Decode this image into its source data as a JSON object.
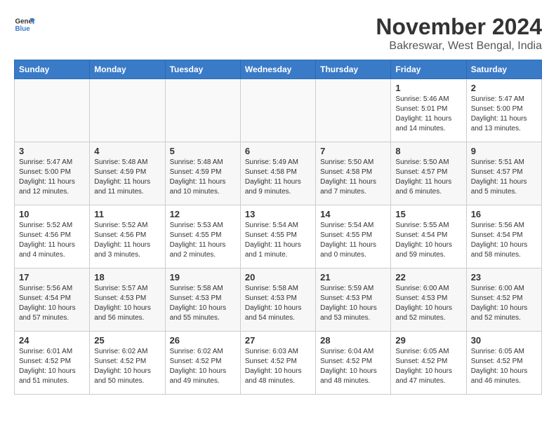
{
  "logo": {
    "line1": "General",
    "line2": "Blue"
  },
  "title": "November 2024",
  "location": "Bakreswar, West Bengal, India",
  "days_of_week": [
    "Sunday",
    "Monday",
    "Tuesday",
    "Wednesday",
    "Thursday",
    "Friday",
    "Saturday"
  ],
  "weeks": [
    {
      "days": [
        {
          "number": "",
          "empty": true
        },
        {
          "number": "",
          "empty": true
        },
        {
          "number": "",
          "empty": true
        },
        {
          "number": "",
          "empty": true
        },
        {
          "number": "",
          "empty": true
        },
        {
          "number": "1",
          "sunrise": "Sunrise: 5:46 AM",
          "sunset": "Sunset: 5:01 PM",
          "daylight": "Daylight: 11 hours and 14 minutes."
        },
        {
          "number": "2",
          "sunrise": "Sunrise: 5:47 AM",
          "sunset": "Sunset: 5:00 PM",
          "daylight": "Daylight: 11 hours and 13 minutes."
        }
      ]
    },
    {
      "days": [
        {
          "number": "3",
          "sunrise": "Sunrise: 5:47 AM",
          "sunset": "Sunset: 5:00 PM",
          "daylight": "Daylight: 11 hours and 12 minutes."
        },
        {
          "number": "4",
          "sunrise": "Sunrise: 5:48 AM",
          "sunset": "Sunset: 4:59 PM",
          "daylight": "Daylight: 11 hours and 11 minutes."
        },
        {
          "number": "5",
          "sunrise": "Sunrise: 5:48 AM",
          "sunset": "Sunset: 4:59 PM",
          "daylight": "Daylight: 11 hours and 10 minutes."
        },
        {
          "number": "6",
          "sunrise": "Sunrise: 5:49 AM",
          "sunset": "Sunset: 4:58 PM",
          "daylight": "Daylight: 11 hours and 9 minutes."
        },
        {
          "number": "7",
          "sunrise": "Sunrise: 5:50 AM",
          "sunset": "Sunset: 4:58 PM",
          "daylight": "Daylight: 11 hours and 7 minutes."
        },
        {
          "number": "8",
          "sunrise": "Sunrise: 5:50 AM",
          "sunset": "Sunset: 4:57 PM",
          "daylight": "Daylight: 11 hours and 6 minutes."
        },
        {
          "number": "9",
          "sunrise": "Sunrise: 5:51 AM",
          "sunset": "Sunset: 4:57 PM",
          "daylight": "Daylight: 11 hours and 5 minutes."
        }
      ]
    },
    {
      "days": [
        {
          "number": "10",
          "sunrise": "Sunrise: 5:52 AM",
          "sunset": "Sunset: 4:56 PM",
          "daylight": "Daylight: 11 hours and 4 minutes."
        },
        {
          "number": "11",
          "sunrise": "Sunrise: 5:52 AM",
          "sunset": "Sunset: 4:56 PM",
          "daylight": "Daylight: 11 hours and 3 minutes."
        },
        {
          "number": "12",
          "sunrise": "Sunrise: 5:53 AM",
          "sunset": "Sunset: 4:55 PM",
          "daylight": "Daylight: 11 hours and 2 minutes."
        },
        {
          "number": "13",
          "sunrise": "Sunrise: 5:54 AM",
          "sunset": "Sunset: 4:55 PM",
          "daylight": "Daylight: 11 hours and 1 minute."
        },
        {
          "number": "14",
          "sunrise": "Sunrise: 5:54 AM",
          "sunset": "Sunset: 4:55 PM",
          "daylight": "Daylight: 11 hours and 0 minutes."
        },
        {
          "number": "15",
          "sunrise": "Sunrise: 5:55 AM",
          "sunset": "Sunset: 4:54 PM",
          "daylight": "Daylight: 10 hours and 59 minutes."
        },
        {
          "number": "16",
          "sunrise": "Sunrise: 5:56 AM",
          "sunset": "Sunset: 4:54 PM",
          "daylight": "Daylight: 10 hours and 58 minutes."
        }
      ]
    },
    {
      "days": [
        {
          "number": "17",
          "sunrise": "Sunrise: 5:56 AM",
          "sunset": "Sunset: 4:54 PM",
          "daylight": "Daylight: 10 hours and 57 minutes."
        },
        {
          "number": "18",
          "sunrise": "Sunrise: 5:57 AM",
          "sunset": "Sunset: 4:53 PM",
          "daylight": "Daylight: 10 hours and 56 minutes."
        },
        {
          "number": "19",
          "sunrise": "Sunrise: 5:58 AM",
          "sunset": "Sunset: 4:53 PM",
          "daylight": "Daylight: 10 hours and 55 minutes."
        },
        {
          "number": "20",
          "sunrise": "Sunrise: 5:58 AM",
          "sunset": "Sunset: 4:53 PM",
          "daylight": "Daylight: 10 hours and 54 minutes."
        },
        {
          "number": "21",
          "sunrise": "Sunrise: 5:59 AM",
          "sunset": "Sunset: 4:53 PM",
          "daylight": "Daylight: 10 hours and 53 minutes."
        },
        {
          "number": "22",
          "sunrise": "Sunrise: 6:00 AM",
          "sunset": "Sunset: 4:53 PM",
          "daylight": "Daylight: 10 hours and 52 minutes."
        },
        {
          "number": "23",
          "sunrise": "Sunrise: 6:00 AM",
          "sunset": "Sunset: 4:52 PM",
          "daylight": "Daylight: 10 hours and 52 minutes."
        }
      ]
    },
    {
      "days": [
        {
          "number": "24",
          "sunrise": "Sunrise: 6:01 AM",
          "sunset": "Sunset: 4:52 PM",
          "daylight": "Daylight: 10 hours and 51 minutes."
        },
        {
          "number": "25",
          "sunrise": "Sunrise: 6:02 AM",
          "sunset": "Sunset: 4:52 PM",
          "daylight": "Daylight: 10 hours and 50 minutes."
        },
        {
          "number": "26",
          "sunrise": "Sunrise: 6:02 AM",
          "sunset": "Sunset: 4:52 PM",
          "daylight": "Daylight: 10 hours and 49 minutes."
        },
        {
          "number": "27",
          "sunrise": "Sunrise: 6:03 AM",
          "sunset": "Sunset: 4:52 PM",
          "daylight": "Daylight: 10 hours and 48 minutes."
        },
        {
          "number": "28",
          "sunrise": "Sunrise: 6:04 AM",
          "sunset": "Sunset: 4:52 PM",
          "daylight": "Daylight: 10 hours and 48 minutes."
        },
        {
          "number": "29",
          "sunrise": "Sunrise: 6:05 AM",
          "sunset": "Sunset: 4:52 PM",
          "daylight": "Daylight: 10 hours and 47 minutes."
        },
        {
          "number": "30",
          "sunrise": "Sunrise: 6:05 AM",
          "sunset": "Sunset: 4:52 PM",
          "daylight": "Daylight: 10 hours and 46 minutes."
        }
      ]
    }
  ]
}
